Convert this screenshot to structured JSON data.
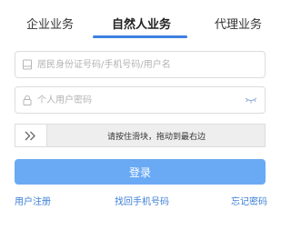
{
  "tabs": [
    {
      "label": "企业业务",
      "active": false
    },
    {
      "label": "自然人业务",
      "active": true
    },
    {
      "label": "代理业务",
      "active": false
    }
  ],
  "form": {
    "username_placeholder": "居民身份证号码/手机号码/用户名",
    "username_value": "",
    "password_placeholder": "个人用户密码",
    "password_value": "",
    "slider_text": "请按住滑块，拖动到最右边"
  },
  "login_button": "登录",
  "links": {
    "register": "用户注册",
    "retrieve_phone": "找回手机号码",
    "forgot_password": "忘记密码"
  },
  "colors": {
    "accent": "#3d7fe0",
    "button": "#6aaaf4",
    "link": "#3c7fd6"
  },
  "icons": {
    "username": "user-card-icon",
    "password": "lock-icon",
    "eye": "eye-closed-icon",
    "slider": "double-chevron-right-icon"
  }
}
